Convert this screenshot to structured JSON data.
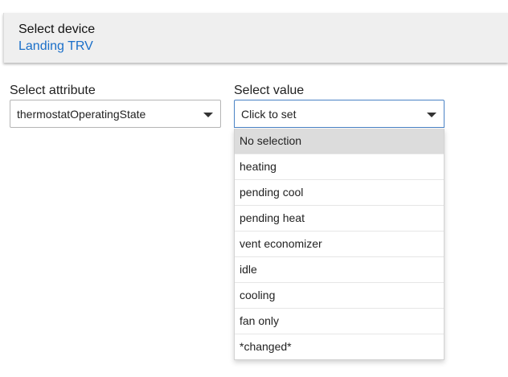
{
  "device_card": {
    "heading": "Select device",
    "device_name": "Landing TRV"
  },
  "attribute": {
    "label": "Select attribute",
    "value": "thermostatOperatingState"
  },
  "value_select": {
    "label": "Select value",
    "value": "Click to set",
    "options": [
      {
        "label": "No selection",
        "selected": true
      },
      {
        "label": "heating"
      },
      {
        "label": "pending cool"
      },
      {
        "label": "pending heat"
      },
      {
        "label": "vent economizer"
      },
      {
        "label": "idle"
      },
      {
        "label": "cooling"
      },
      {
        "label": "fan only"
      },
      {
        "label": "*changed*"
      }
    ]
  },
  "colors": {
    "link": "#1a6fc9",
    "card_bg": "#efefef",
    "focus_border": "#4a82c5",
    "option_highlight": "#dcdcdc"
  },
  "icons": {
    "dropdown_caret": "caret-down-icon"
  }
}
